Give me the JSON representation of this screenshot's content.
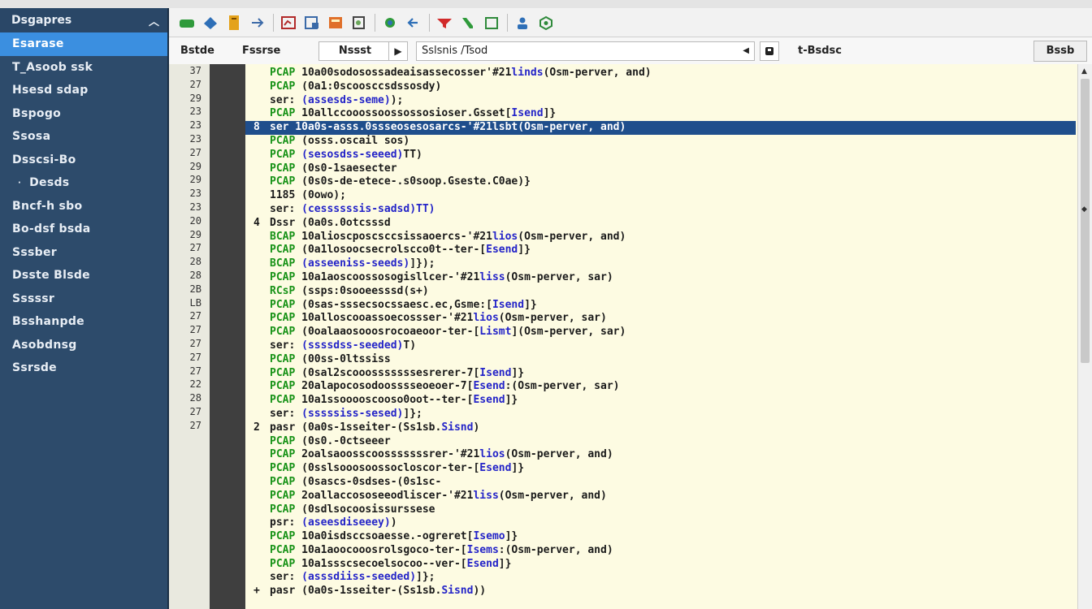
{
  "sidebar": {
    "header": "Dsgapres",
    "items": [
      {
        "label": "Esarase",
        "active": true
      },
      {
        "label": "T_Asoob ssk"
      },
      {
        "label": "Hsesd sdap"
      },
      {
        "label": "Bspogo"
      },
      {
        "label": "Ssosa"
      },
      {
        "label": "Dsscsi-Bo"
      },
      {
        "label": "Desds",
        "sub": true
      },
      {
        "label": "Bncf-h sbo"
      },
      {
        "label": "Bo-dsf bsda"
      },
      {
        "label": "Sssber"
      },
      {
        "label": "Dsste Blsde"
      },
      {
        "label": "Sssssr"
      },
      {
        "label": "Bsshanpde"
      },
      {
        "label": "Asobdnsg"
      },
      {
        "label": "Ssrsde"
      }
    ]
  },
  "toolbar": {
    "icons": [
      "open-file-icon",
      "save-icon",
      "document-icon",
      "export-icon",
      "chart-icon",
      "print-icon",
      "image-icon",
      "zoom-icon",
      "refresh-icon",
      "back-arrow-icon",
      "filter-icon",
      "phone-icon",
      "window-icon",
      "user-icon",
      "settings-icon"
    ]
  },
  "filterbar": {
    "label1": "Bstde",
    "label2": "Fssrse",
    "box": "Nssst",
    "input_value": "Sslsnis /Tsod",
    "label3": "t-Bsdsc",
    "button": "Bssb"
  },
  "line_numbers": [
    "37",
    "27",
    "29",
    "23",
    "23",
    "23",
    "27",
    "29",
    "29",
    "23",
    "23",
    "20",
    "29",
    "27",
    "28",
    "28",
    "2B",
    "LB",
    "27",
    "27",
    "27",
    "27",
    "27",
    "22",
    "28",
    "27",
    "27"
  ],
  "code_lines": [
    {
      "mark": "",
      "kw": "PCAP",
      "rest": " 10a00sodosossadeaisassecosser'#21",
      "blu": "linds",
      "tail": "(Osm-perver, and)"
    },
    {
      "mark": "",
      "kw": "PCAP",
      "rest": " (0a1:0scoosccsdssosdy)",
      "blu": "",
      "tail": ""
    },
    {
      "mark": "",
      "kw": "ser:",
      "plain": true,
      "rest": " ",
      "blu": "(assesds-seme)",
      "tail": ");"
    },
    {
      "mark": "",
      "kw": "PCAP",
      "rest": " 10allccooossoossossosioser.Gsset[",
      "blu": "Isend",
      "tail": "]}"
    },
    {
      "mark": "8",
      "kw": "ser",
      "plain": true,
      "rest": " 10a0s-asss.0ssseosesosarcs-'#21",
      "blu": "lsbt",
      "tail": "(Osm-perver, and)",
      "selected": true
    },
    {
      "mark": "",
      "kw": "PCAP",
      "rest": " (osss.oscail sos)",
      "blu": "",
      "tail": ""
    },
    {
      "mark": "",
      "kw": "PCAP",
      "rest": " ",
      "blu": "(sesosdss-seeed)",
      "tail": "TT)"
    },
    {
      "mark": "",
      "kw": "PCAP",
      "rest": " (0s0-1saesecter",
      "blu": "",
      "tail": ""
    },
    {
      "mark": "",
      "kw": "PCAP",
      "rest": " (0s0s-de-etece-.s0soop.Gseste.C0ae)}",
      "blu": "",
      "tail": ""
    },
    {
      "mark": "",
      "kw": "1185",
      "plain": true,
      "rest": " (0owo);",
      "blu": "",
      "tail": ""
    },
    {
      "mark": "",
      "kw": "ser:",
      "plain": true,
      "rest": " ",
      "blu": "(cessssssis-sadsd)TT)",
      "tail": ""
    },
    {
      "mark": "4",
      "kw": "Dssr",
      "plain": true,
      "rest": " (0a0s.0otcsssd",
      "blu": "",
      "tail": ""
    },
    {
      "mark": "",
      "kw": "BCAP",
      "rest": " 10alioscposcsccsissaoercs-'#21",
      "blu": "lios",
      "tail": "(Osm-perver, and)"
    },
    {
      "mark": "",
      "kw": "PCAP",
      "rest": " (0a1losoocsecrolscco0t--ter-[",
      "blu": "Esend",
      "tail": "]}"
    },
    {
      "mark": "",
      "kw": "BCAP",
      "rest": " ",
      "blu": "(asseeniss-seeds)",
      "tail": "]});"
    },
    {
      "mark": "",
      "kw": "PCAP",
      "rest": " 10a1aoscoossosogisllcer-'#21",
      "blu": "liss",
      "tail": "(Osm-perver, sar)"
    },
    {
      "mark": "",
      "kw": "RCsP",
      "rest": " (ssps:0sooeesssd(s+)",
      "blu": "",
      "tail": ""
    },
    {
      "mark": "",
      "kw": "PCAP",
      "rest": " (0sas-sssecsocssaesc.ec,Gsme:[",
      "blu": "Isend",
      "tail": "]}"
    },
    {
      "mark": "",
      "kw": "PCAP",
      "rest": " 10alloscooassoecossser-'#21",
      "blu": "lios",
      "tail": "(Osm-perver, sar)"
    },
    {
      "mark": "",
      "kw": "PCAP",
      "rest": " (0oalaaosooosrocoaeoor-ter-[",
      "blu": "Lismt",
      "tail": "](Osm-perver, sar)"
    },
    {
      "mark": "",
      "kw": "ser:",
      "plain": true,
      "rest": " ",
      "blu": "(ssssdss-seeded)",
      "tail": "T)"
    },
    {
      "mark": "",
      "kw": "PCAP",
      "rest": " (00ss-0ltssiss",
      "blu": "",
      "tail": ""
    },
    {
      "mark": "",
      "kw": "PCAP",
      "rest": " (0sal2scooosssssssesrerer-7[",
      "blu": "Isend",
      "tail": "]}"
    },
    {
      "mark": "",
      "kw": "PCAP",
      "rest": " 20alapocosodoosssseoeoer-7[",
      "blu": "Esend",
      "tail": ":(Osm-perver, sar)"
    },
    {
      "mark": "",
      "kw": "PCAP",
      "rest": " 10a1ssooooscooso0oot--ter-[",
      "blu": "Esend",
      "tail": "]}"
    },
    {
      "mark": "",
      "kw": "ser:",
      "plain": true,
      "rest": " ",
      "blu": "(sssssiss-sesed)",
      "tail": "]};"
    },
    {
      "mark": "2",
      "kw": "pasr",
      "plain": true,
      "rest": " (0a0s-1sseiter-(Ss1sb.",
      "blu": "Sisnd",
      "tail": ")"
    },
    {
      "mark": "",
      "kw": "PCAP",
      "rest": " (0s0.-0ctseeer",
      "blu": "",
      "tail": ""
    },
    {
      "mark": "",
      "kw": "PCAP",
      "rest": " 2oalsaoosscoosssssssrer-'#21",
      "blu": "lios",
      "tail": "(Osm-perver, and)"
    },
    {
      "mark": "",
      "kw": "PCAP",
      "rest": " (0sslsooosoossocloscor-ter-[",
      "blu": "Esend",
      "tail": "]}"
    },
    {
      "mark": "",
      "kw": "PCAP",
      "rest": " (0sascs-0sdses-(0s1sc-",
      "blu": "",
      "tail": ""
    },
    {
      "mark": "",
      "kw": "PCAP",
      "rest": " 2oallaccososeeodliscer-'#21",
      "blu": "liss",
      "tail": "(Osm-perver, and)"
    },
    {
      "mark": "",
      "kw": "PCAP",
      "rest": " (0sdlsocoosissurssese",
      "blu": "",
      "tail": ""
    },
    {
      "mark": "",
      "kw": "psr:",
      "plain": true,
      "rest": " ",
      "blu": "(aseesdiseeey)",
      "tail": ")"
    },
    {
      "mark": "",
      "kw": "PCAP",
      "rest": " 10a0isdsccsoaesse.-ogreret[",
      "blu": "Isemo",
      "tail": "]}"
    },
    {
      "mark": "",
      "kw": "PCAP",
      "rest": " 10a1aoocooosrolsgoco-ter-[",
      "blu": "Isems",
      "tail": ":(Osm-perver, and)"
    },
    {
      "mark": "",
      "kw": "PCAP",
      "rest": " 10a1ssscsecoelsocoo--ver-[",
      "blu": "Esend",
      "tail": "]}"
    },
    {
      "mark": "",
      "kw": "ser:",
      "plain": true,
      "rest": " ",
      "blu": "(asssdiiss-seeded)",
      "tail": "]};"
    },
    {
      "mark": "+",
      "kw": "pasr",
      "plain": true,
      "rest": " (0a0s-1sseiter-(Ss1sb.",
      "blu": "Sisnd",
      "tail": "))"
    }
  ]
}
